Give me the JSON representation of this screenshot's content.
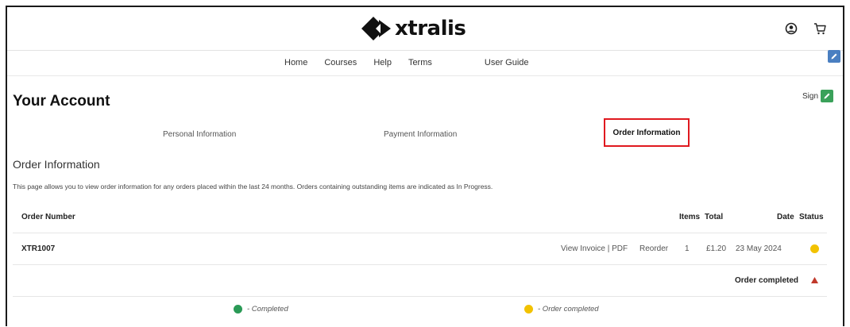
{
  "brand": {
    "name": "xtralis"
  },
  "nav": {
    "items": [
      "Home",
      "Courses",
      "Help",
      "Terms",
      "User Guide"
    ]
  },
  "header": {
    "account_icon": "account-circle-icon",
    "cart_icon": "cart-icon"
  },
  "page": {
    "title": "Your Account",
    "sign_label": "Sign"
  },
  "tabs": {
    "personal": "Personal Information",
    "payment": "Payment Information",
    "order": "Order Information"
  },
  "section": {
    "title": "Order Information",
    "description": "This page allows you to view order information for any orders placed within the last 24 months. Orders containing outstanding items are indicated as In Progress."
  },
  "table": {
    "headers": {
      "order_number": "Order Number",
      "items": "Items",
      "total": "Total",
      "date": "Date",
      "status": "Status"
    },
    "rows": [
      {
        "order_number": "XTR1007",
        "view_invoice": "View Invoice | PDF",
        "reorder": "Reorder",
        "items": "1",
        "total": "£1.20",
        "date": "23 May 2024",
        "status_color": "#f2c200",
        "detail_status": "Order completed"
      }
    ]
  },
  "legend": {
    "completed": {
      "label": "- Completed",
      "color": "#2a9a56"
    },
    "order_completed": {
      "label": "- Order completed",
      "color": "#f2c200"
    }
  },
  "colors": {
    "accent_red": "#e0191f",
    "edit_blue": "#4a7fc1",
    "edit_green": "#3aa15a",
    "caret_red": "#c0392b"
  }
}
